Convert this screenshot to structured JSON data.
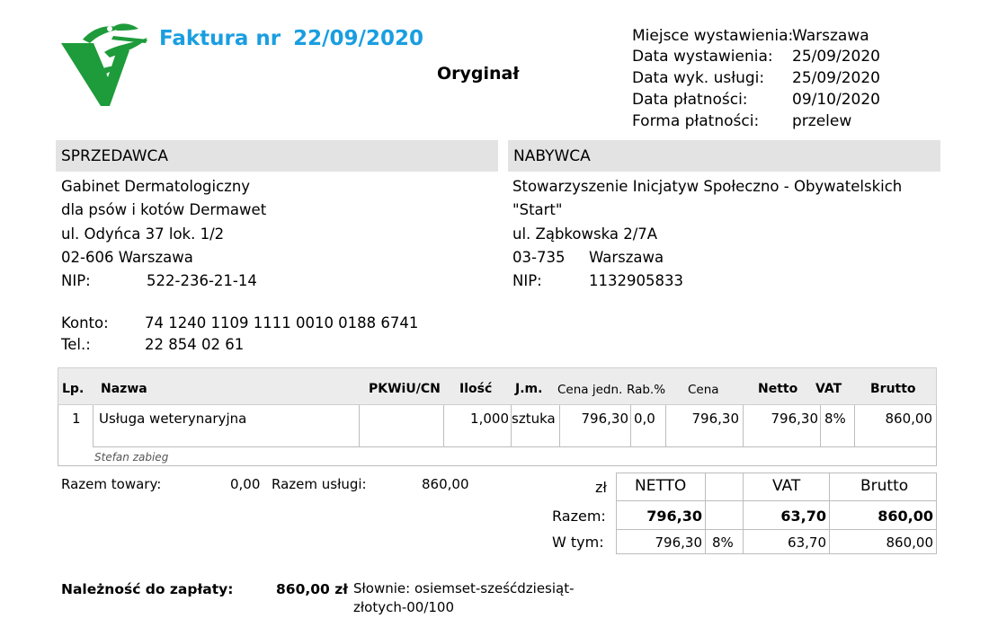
{
  "logo_icon": "veterinary-caduceus-logo",
  "header": {
    "title_prefix": "Faktura nr",
    "title_number": "22/09/2020",
    "copy_label": "Oryginał",
    "meta": [
      {
        "label": "Miejsce wystawienia:",
        "value": "Warszawa"
      },
      {
        "label": "Data wystawienia:",
        "value": "25/09/2020"
      },
      {
        "label": "Data wyk. usługi:",
        "value": "25/09/2020"
      },
      {
        "label": "Data płatności:",
        "value": "09/10/2020"
      },
      {
        "label": "Forma płatności:",
        "value": "przelew"
      }
    ]
  },
  "seller": {
    "heading": "SPRZEDAWCA",
    "line1": "Gabinet Dermatologiczny",
    "line2": "dla psów i kotów Dermawet",
    "line3": "ul. Odyńca 37 lok. 1/2",
    "line4": "02-606 Warszawa",
    "nip_label": "NIP:",
    "nip": "522-236-21-14",
    "account_label": "Konto:",
    "account": "74 1240 1109 1111 0010 0188 6741",
    "tel_label": "Tel.:",
    "tel": "22 854 02 61"
  },
  "buyer": {
    "heading": "NABYWCA",
    "line1": "Stowarzyszenie Inicjatyw Społeczno - Obywatelskich",
    "line2": "\"Start\"",
    "line3": "ul. Ząbkowska 2/7A",
    "postcode": "03-735",
    "city": "Warszawa",
    "nip_label": "NIP:",
    "nip": "1132905833"
  },
  "items_table": {
    "headers": {
      "lp": "Lp.",
      "name": "Nazwa",
      "pkwiu": "PKWiU/CN",
      "qty": "Ilość",
      "unit": "J.m.",
      "unit_price": "Cena jedn.",
      "discount": "Rab.%",
      "price": "Cena",
      "net": "Netto",
      "vat": "VAT",
      "gross": "Brutto"
    },
    "rows": [
      {
        "lp": "1",
        "name": "Usługa weterynaryjna",
        "pkwiu": "",
        "qty": "1,000",
        "unit": "sztuka",
        "unit_price": "796,30",
        "discount": "0,0",
        "price": "796,30",
        "net": "796,30",
        "vat": "8%",
        "gross": "860,00",
        "note": "Stefan zabieg"
      }
    ]
  },
  "summary": {
    "goods_label": "Razem towary:",
    "goods_value": "0,00",
    "services_label": "Razem usługi:",
    "services_value": "860,00"
  },
  "totals": {
    "currency": "zł",
    "col_net": "NETTO",
    "col_vat": "VAT",
    "col_gross": "Brutto",
    "total_label": "Razem:",
    "total_net": "796,30",
    "total_vat": "63,70",
    "total_gross": "860,00",
    "incl_label": "W tym:",
    "incl_net": "796,30",
    "incl_rate": "8%",
    "incl_vat": "63,70",
    "incl_gross": "860,00"
  },
  "payment": {
    "label": "Należność do zapłaty:",
    "amount": "860,00 zł",
    "words": "Słownie: osiemset-sześćdziesiąt-złotych-00/100"
  },
  "colors": {
    "title": "#1a9ee0",
    "logo": "#1e9b3a",
    "section_bg": "#e3e3e3"
  }
}
